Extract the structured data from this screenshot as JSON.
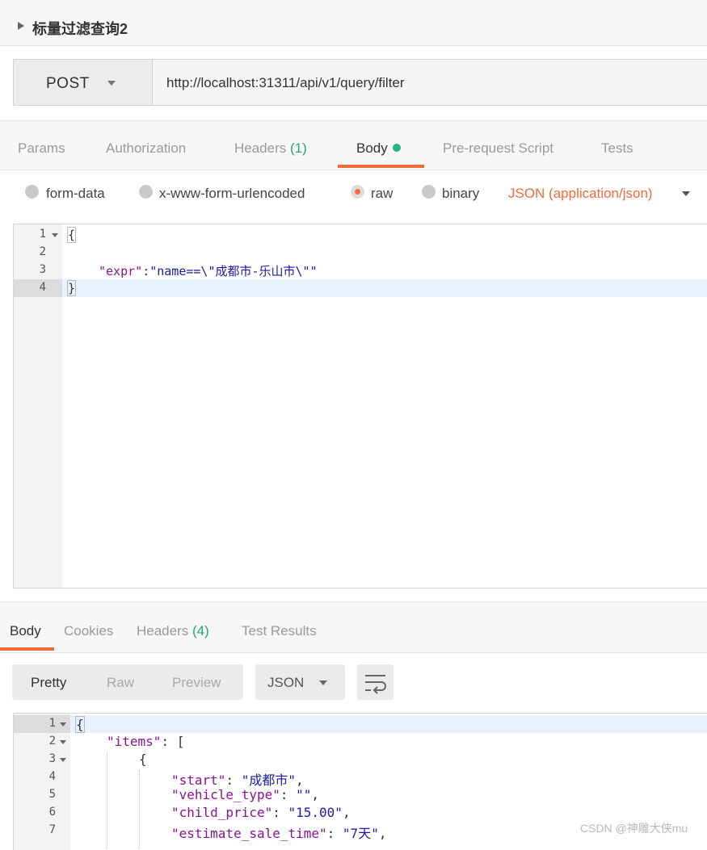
{
  "request": {
    "title": "标量过滤查询2",
    "method": "POST",
    "url": "http://localhost:31311/api/v1/query/filter",
    "tabs": [
      {
        "label": "Params"
      },
      {
        "label": "Authorization"
      },
      {
        "label": "Headers",
        "count": "(1)"
      },
      {
        "label": "Body"
      },
      {
        "label": "Pre-request Script"
      },
      {
        "label": "Tests"
      }
    ],
    "active_tab": "Body",
    "body_modes": [
      "form-data",
      "x-www-form-urlencoded",
      "raw",
      "binary"
    ],
    "selected_mode": "raw",
    "content_type": "JSON (application/json)",
    "editor": {
      "line_numbers": [
        "1",
        "2",
        "3",
        "4"
      ],
      "open_brace": "{",
      "key": "\"expr\"",
      "colon": ":",
      "value": "\"name==\\\"成都市-乐山市\\\"\"",
      "close_brace": "}"
    }
  },
  "response": {
    "tabs": [
      {
        "label": "Body"
      },
      {
        "label": "Cookies"
      },
      {
        "label": "Headers",
        "count": "(4)"
      },
      {
        "label": "Test Results"
      }
    ],
    "active_tab": "Body",
    "views": [
      "Pretty",
      "Raw",
      "Preview"
    ],
    "active_view": "Pretty",
    "format": "JSON",
    "wrap_icon": "wrap-lines-icon",
    "line_numbers": [
      "1",
      "2",
      "3",
      "4",
      "5",
      "6",
      "7"
    ],
    "lines": {
      "l1": "{",
      "l2_key": "\"items\"",
      "l2_rest": ": [",
      "l3": "{",
      "l4_key": "\"start\"",
      "l4_val": "\"成都市\"",
      "l5_key": "\"vehicle_type\"",
      "l5_val": "\"\"",
      "l6_key": "\"child_price\"",
      "l6_val": "\"15.00\"",
      "l7_key": "\"estimate_sale_time\"",
      "l7_val": "\"7天\""
    }
  },
  "watermark": "CSDN @神雕大侠mu",
  "colors": {
    "accent": "#f26b3a",
    "success": "#26b47a",
    "json_key": "#881391",
    "json_string": "#1a1aa6"
  }
}
